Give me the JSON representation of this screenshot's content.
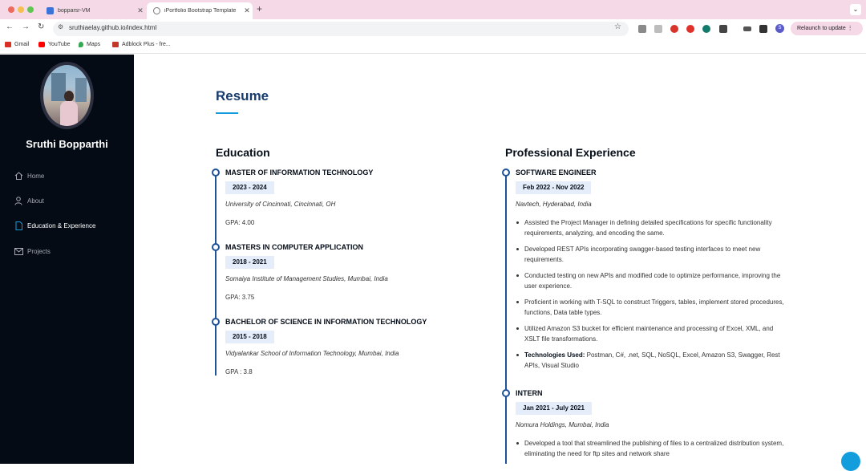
{
  "browser": {
    "tabs": [
      {
        "title": "bopparsr-VM"
      },
      {
        "title": "iPortfolio Bootstrap Template"
      }
    ],
    "url": "sruthiaelay.github.io/index.html",
    "relaunch_label": "Relaunch to update",
    "profile_initial": "S",
    "bookmarks": [
      {
        "label": "Gmail"
      },
      {
        "label": "YouTube"
      },
      {
        "label": "Maps"
      },
      {
        "label": "Adblock Plus - fre..."
      }
    ]
  },
  "sidebar": {
    "name": "Sruthi Bopparthi",
    "nav": [
      {
        "label": "Home",
        "icon": "house-icon"
      },
      {
        "label": "About",
        "icon": "person-icon"
      },
      {
        "label": "Education & Experience",
        "icon": "file-icon",
        "active": true
      },
      {
        "label": "Projects",
        "icon": "envelope-icon"
      }
    ]
  },
  "resume": {
    "title": "Resume",
    "education": {
      "heading": "Education",
      "items": [
        {
          "title": "MASTER OF INFORMATION TECHNOLOGY",
          "date": "2023 - 2024",
          "place": "University of Cincinnati, Cincinnati, OH",
          "gpa": "GPA: 4.00"
        },
        {
          "title": "MASTERS IN COMPUTER APPLICATION",
          "date": "2018 - 2021",
          "place": "Somaiya Institute of Management Studies, Mumbai, India",
          "gpa": "GPA: 3.75"
        },
        {
          "title": "BACHELOR OF SCIENCE IN INFORMATION TECHNOLOGY",
          "date": "2015 - 2018",
          "place": "Vidyalankar School of Information Technology, Mumbai, India",
          "gpa": "GPA : 3.8"
        }
      ]
    },
    "experience": {
      "heading": "Professional Experience",
      "items": [
        {
          "title": "SOFTWARE ENGINEER",
          "date": "Feb 2022 - Nov 2022",
          "place": "Navtech, Hyderabad, India",
          "bullets": [
            "Assisted the Project Manager in defining detailed specifications for specific functionality requirements, analyzing, and encoding the same.",
            "Developed REST APIs incorporating swagger-based testing interfaces to meet new requirements.",
            "Conducted testing on new APIs and modified code to optimize performance, improving the user experience.",
            "Proficient in working with T-SQL to construct Triggers, tables, implement stored procedures, functions, Data table types.",
            "Utilized Amazon S3 bucket for efficient maintenance and processing of Excel, XML, and XSLT file transformations."
          ],
          "tech_label": "Technologies Used:",
          "tech_text": " Postman, C#, .net, SQL, NoSQL, Excel, Amazon S3, Swagger, Rest APIs, Visual Studio"
        },
        {
          "title": "INTERN",
          "date": "Jan 2021 - July 2021",
          "place": "Nomura Holdings, Mumbai, India",
          "bullets": [
            "Developed a tool that streamlined the publishing of files to a centralized distribution system, eliminating the need for ftp sites and network share"
          ]
        }
      ]
    }
  },
  "colors": {
    "accent": "#149ddd",
    "sidebar_bg": "#040b14",
    "title": "#173b6c",
    "timeline": "#1f5297",
    "date_bg": "#e4edf9"
  }
}
